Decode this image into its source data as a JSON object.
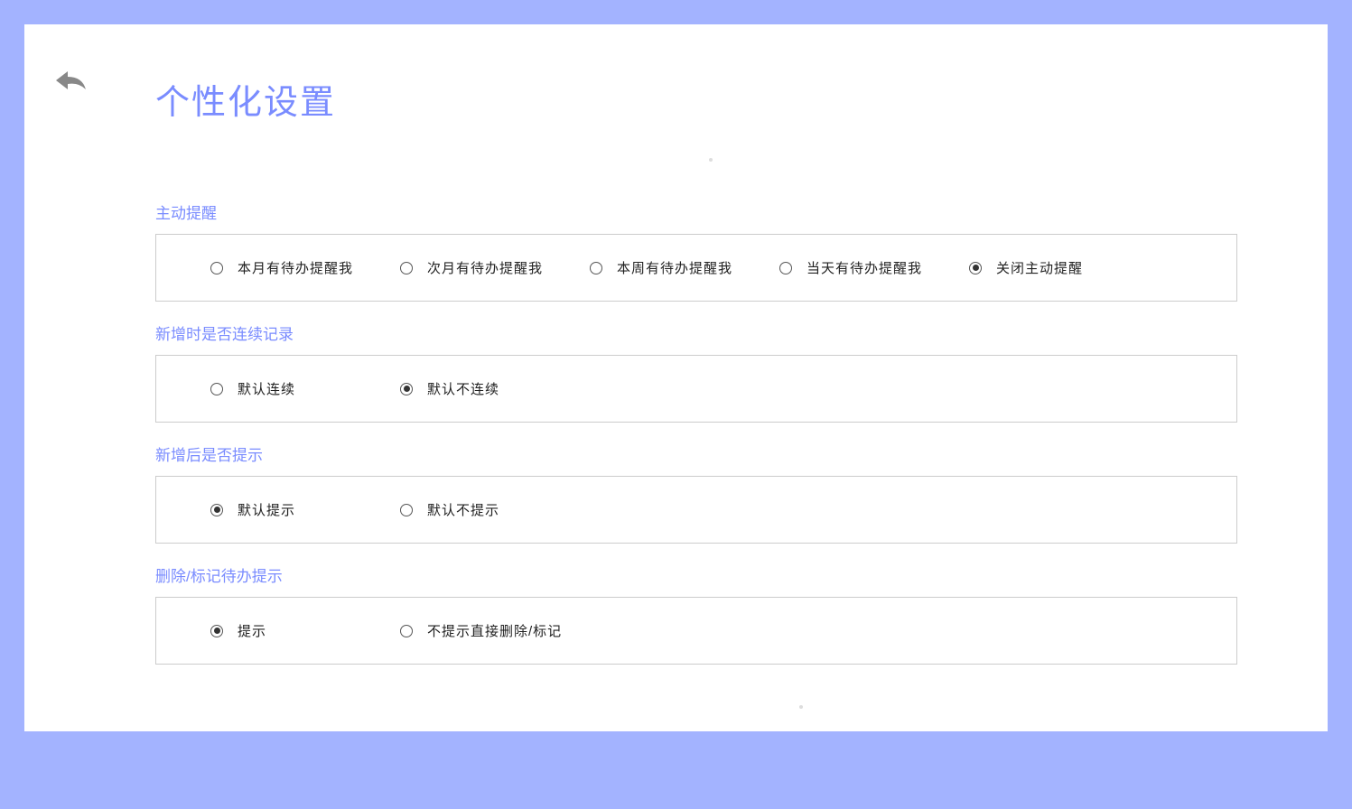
{
  "page_title": "个性化设置",
  "sections": [
    {
      "title": "主动提醒",
      "options": [
        {
          "label": "本月有待办提醒我",
          "selected": false
        },
        {
          "label": "次月有待办提醒我",
          "selected": false
        },
        {
          "label": "本周有待办提醒我",
          "selected": false
        },
        {
          "label": "当天有待办提醒我",
          "selected": false
        },
        {
          "label": "关闭主动提醒",
          "selected": true
        }
      ]
    },
    {
      "title": "新增时是否连续记录",
      "options": [
        {
          "label": "默认连续",
          "selected": false
        },
        {
          "label": "默认不连续",
          "selected": true
        }
      ]
    },
    {
      "title": "新增后是否提示",
      "options": [
        {
          "label": "默认提示",
          "selected": true
        },
        {
          "label": "默认不提示",
          "selected": false
        }
      ]
    },
    {
      "title": "删除/标记待办提示",
      "options": [
        {
          "label": "提示",
          "selected": true
        },
        {
          "label": "不提示直接删除/标记",
          "selected": false
        }
      ]
    }
  ]
}
